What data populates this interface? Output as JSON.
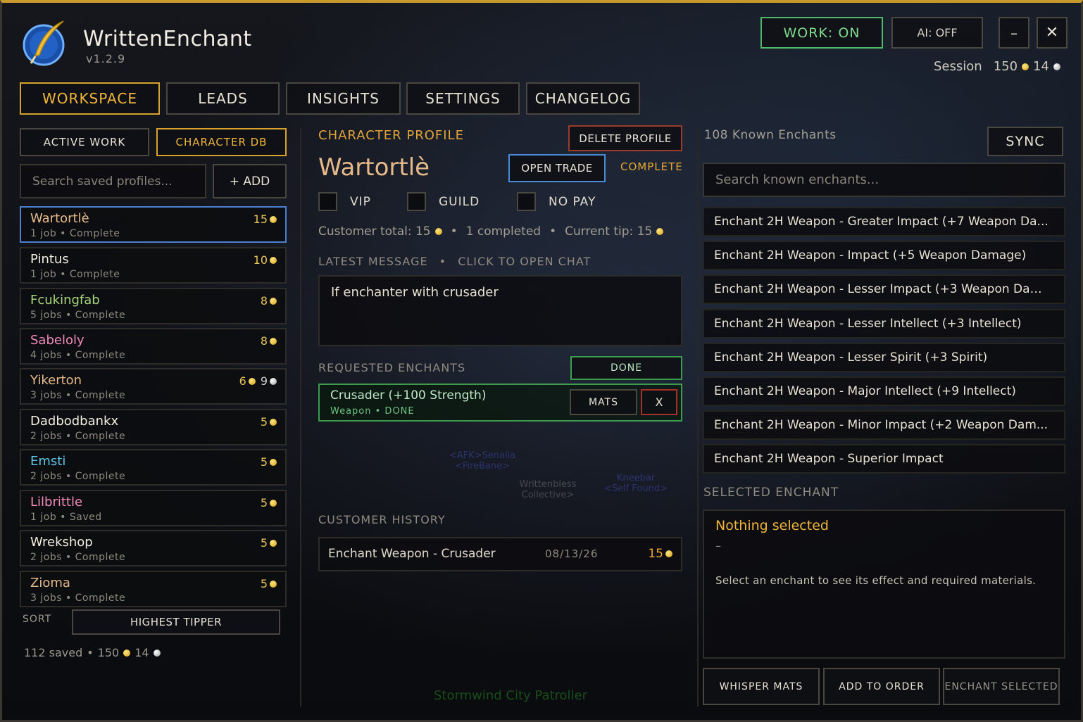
{
  "app": {
    "title": "WrittenEnchant",
    "version": "v1.2.9"
  },
  "header": {
    "work_label": "WORK: ON",
    "ai_label": "AI: OFF",
    "minimize_label": "–",
    "close_label": "✕",
    "session_label": "Session",
    "session_gold": "150",
    "session_silver": "14"
  },
  "tabs": [
    "WORKSPACE",
    "LEADS",
    "INSIGHTS",
    "SETTINGS",
    "CHANGELOG"
  ],
  "left": {
    "subtabs": [
      "ACTIVE WORK",
      "CHARACTER DB"
    ],
    "search_placeholder": "Search saved profiles...",
    "add_label": "+ ADD",
    "profiles": [
      {
        "name": "Wartortlè",
        "meta": "1 job  •  Complete",
        "gold": "15",
        "silver": "",
        "color": "#e6b98a"
      },
      {
        "name": "Pintus",
        "meta": "1 job  •  Complete",
        "gold": "10",
        "silver": "",
        "color": "#f2ede2"
      },
      {
        "name": "Fcukingfab",
        "meta": "5 jobs  •  Complete",
        "gold": "8",
        "silver": "",
        "color": "#a8d67a"
      },
      {
        "name": "Sabeloly",
        "meta": "4 jobs  •  Complete",
        "gold": "8",
        "silver": "",
        "color": "#f08ab8"
      },
      {
        "name": "Yikerton",
        "meta": "3 jobs  •  Complete",
        "gold": "6",
        "silver": "9",
        "color": "#e6b98a"
      },
      {
        "name": "Dadbodbankx",
        "meta": "2 jobs  •  Complete",
        "gold": "5",
        "silver": "",
        "color": "#f2ede2"
      },
      {
        "name": "Emsti",
        "meta": "2 jobs  •  Complete",
        "gold": "5",
        "silver": "",
        "color": "#5cc6e8"
      },
      {
        "name": "Lilbrittle",
        "meta": "1 job  •  Saved",
        "gold": "5",
        "silver": "",
        "color": "#f08ab8"
      },
      {
        "name": "Wrekshop",
        "meta": "2 jobs  •  Complete",
        "gold": "5",
        "silver": "",
        "color": "#f2ede2"
      },
      {
        "name": "Zioma",
        "meta": "3 jobs  •  Complete",
        "gold": "5",
        "silver": "",
        "color": "#e6b98a"
      }
    ],
    "sort_label": "SORT",
    "sort_value": "HIGHEST TIPPER",
    "footer_saved": "112 saved",
    "footer_gold": "150",
    "footer_silver": "14"
  },
  "middle": {
    "section_title": "CHARACTER PROFILE",
    "delete_label": "DELETE PROFILE",
    "profile_name": "Wartortlè",
    "open_trade_label": "OPEN TRADE",
    "complete_label": "COMPLETE",
    "flags": [
      "VIP",
      "GUILD",
      "NO PAY"
    ],
    "stats": {
      "total_label": "Customer total: 15",
      "completed_label": "1 completed",
      "tip_label": "Current tip: 15"
    },
    "latest_message_label": "LATEST MESSAGE",
    "click_to_open_label": "CLICK TO OPEN CHAT",
    "latest_message": "If enchanter with crusader",
    "requested_label": "REQUESTED ENCHANTS",
    "done_label": "DONE",
    "requested": [
      {
        "name": "Crusader (+100 Strength)",
        "meta": "Weapon  •  DONE",
        "mats_label": "MATS",
        "remove_label": "X"
      }
    ],
    "history_label": "CUSTOMER HISTORY",
    "history": [
      {
        "name": "Enchant Weapon - Crusader",
        "date": "08/13/26",
        "value": "15"
      }
    ]
  },
  "world_text": {
    "nameplate_a": "<AFK>Senalia",
    "nameplate_a2": "<FireBane>",
    "nameplate_b": "Writtenbless",
    "nameplate_b2": "Collective>",
    "nameplate_c": "Kneebar",
    "nameplate_c2": "<Self Found>",
    "patroller": "Stormwind City Patroller"
  },
  "right": {
    "known_count": "108 Known Enchants",
    "sync_label": "SYNC",
    "search_placeholder": "Search known enchants...",
    "enchants": [
      "Enchant 2H Weapon - Greater Impact (+7 Weapon Da...",
      "Enchant 2H Weapon - Impact (+5 Weapon Damage)",
      "Enchant 2H Weapon - Lesser Impact (+3 Weapon Dam...",
      "Enchant 2H Weapon - Lesser Intellect (+3 Intellect)",
      "Enchant 2H Weapon - Lesser Spirit (+3 Spirit)",
      "Enchant 2H Weapon - Major Intellect (+9 Intellect)",
      "Enchant 2H Weapon - Minor Impact (+2 Weapon Dam...",
      "Enchant 2H Weapon - Superior Impact"
    ],
    "selected_label": "SELECTED ENCHANT",
    "selected_name": "Nothing selected",
    "selected_dash": "–",
    "selected_desc": "Select an enchant to see its effect and required materials.",
    "whisper_label": "WHISPER MATS",
    "add_order_label": "ADD TO ORDER",
    "enchant_selected_label": "ENCHANT SELECTED"
  }
}
